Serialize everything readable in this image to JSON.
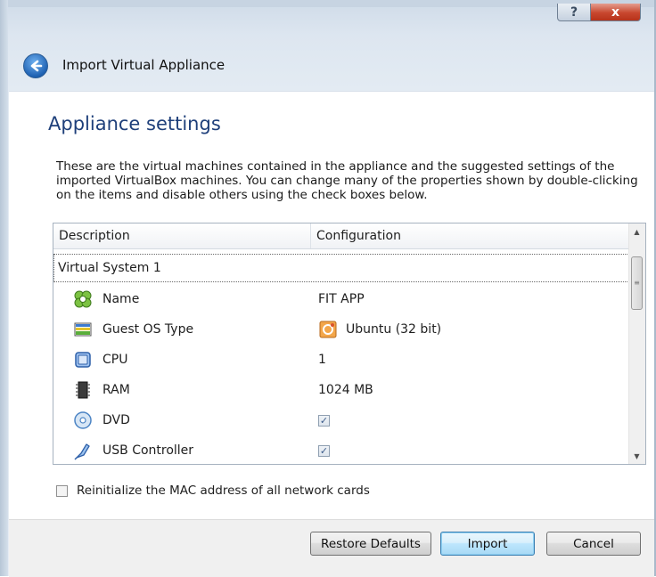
{
  "window": {
    "title": "Import Virtual Appliance",
    "help_glyph": "?",
    "close_glyph": "x"
  },
  "page": {
    "title": "Appliance settings",
    "intro": "These are the virtual machines contained in the appliance and the suggested settings of the imported VirtualBox machines. You can change many of the properties shown by double-clicking on the items and disable others using the check boxes below."
  },
  "tree": {
    "columns": [
      "Description",
      "Configuration"
    ],
    "group_label": "Virtual System 1",
    "rows": [
      {
        "icon": "name-icon",
        "description": "Name",
        "configuration": "FIT APP",
        "type": "text"
      },
      {
        "icon": "guest-os-icon",
        "description": "Guest OS Type",
        "configuration": "Ubuntu (32 bit)",
        "type": "os"
      },
      {
        "icon": "cpu-icon",
        "description": "CPU",
        "configuration": "1",
        "type": "text"
      },
      {
        "icon": "ram-icon",
        "description": "RAM",
        "configuration": "1024 MB",
        "type": "text"
      },
      {
        "icon": "dvd-icon",
        "description": "DVD",
        "configuration": "",
        "type": "checkbox",
        "checked": true
      },
      {
        "icon": "usb-icon",
        "description": "USB Controller",
        "configuration": "",
        "type": "checkbox",
        "checked": true
      }
    ]
  },
  "options": {
    "reinit_mac_label": "Reinitialize the MAC address of all network cards",
    "reinit_mac_checked": false
  },
  "buttons": {
    "restore": "Restore Defaults",
    "import": "Import",
    "cancel": "Cancel"
  },
  "colors": {
    "title_blue": "#1e3f7a",
    "default_button_border": "#3c7fb1",
    "close_red": "#c8472e"
  }
}
